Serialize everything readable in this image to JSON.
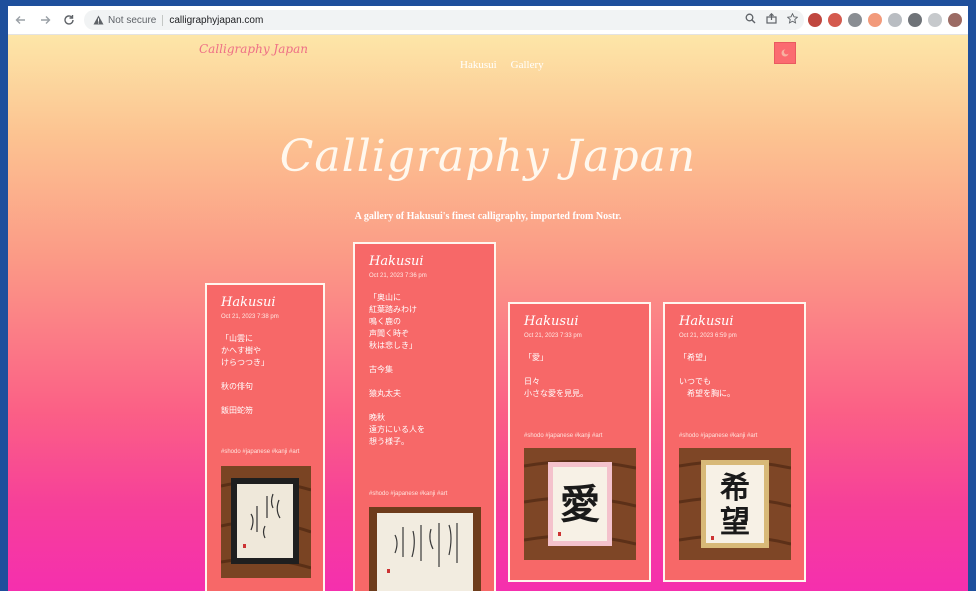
{
  "browser": {
    "security_label": "Not secure",
    "url": "calligraphyjapan.com"
  },
  "site": {
    "brand": "Calligraphy Japan",
    "nav": [
      "Hakusui",
      "Gallery"
    ],
    "hero_title": "Calligraphy Japan",
    "tagline": "A gallery of Hakusui's finest calligraphy, imported from Nostr."
  },
  "cards": [
    {
      "author": "Hakusui",
      "date": "Oct 21, 2023 7:38 pm",
      "body": "「山雲に\nかへす樹や\nけらつつき」\n\n秋の俳句\n\n飯田蛇笏",
      "tags": "#shodo #japanese #kanji #art"
    },
    {
      "author": "Hakusui",
      "date": "Oct 21, 2023 7:36 pm",
      "body": "「奥山に\n紅葉踏みわけ\n鳴く鹿の\n声聞く時ぞ\n秋は悲しき」\n\n古今集\n\n猿丸太夫\n\n晩秋\n遠方にいる人を\n想う様子。",
      "tags": "#shodo #japanese #kanji #art"
    },
    {
      "author": "Hakusui",
      "date": "Oct 21, 2023 7:33 pm",
      "body": "「愛」\n\n日々\n小さな愛を見見。",
      "tags": "#shodo #japanese #kanji #art"
    },
    {
      "author": "Hakusui",
      "date": "Oct 21, 2023 6:59 pm",
      "body": "「希望」\n\nいつでも\n　希望を胸に。",
      "tags": "#shodo #japanese #kanji #art"
    }
  ],
  "artworks": [
    "愛",
    "希",
    "望"
  ]
}
